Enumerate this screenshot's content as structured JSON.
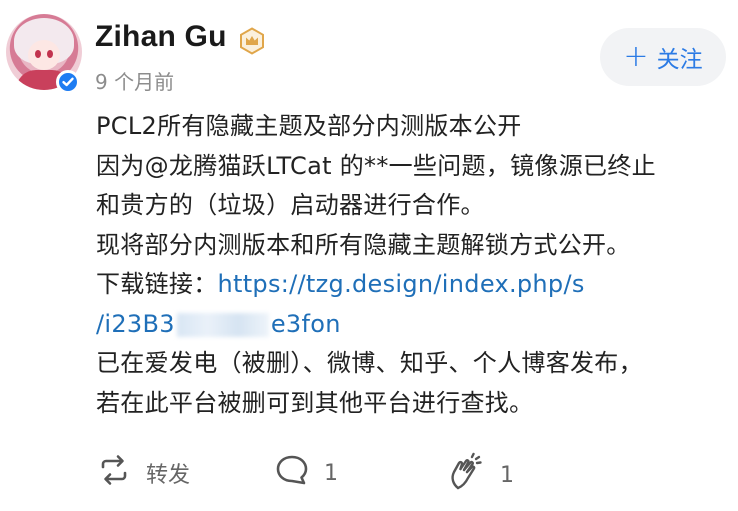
{
  "post": {
    "author": {
      "name": "Zihan Gu"
    },
    "time": "9 个月前",
    "follow_label": "关注",
    "content": {
      "line1": "PCL2所有隐藏主题及部分内测版本公开",
      "line2": "因为@龙腾猫跃LTCat 的**一些问题，镜像源已终止",
      "line3": "和贵方的（垃圾）启动器进行合作。",
      "line4": "现将部分内测版本和所有隐藏主题解锁方式公开。",
      "download_prefix": "下载链接：",
      "link_part1": "https://tzg.design/index.php/s",
      "link_part2_start": "/i23B3",
      "link_part2_end": "e3fon",
      "line7": "已在爱发电（被删）、微博、知乎、个人博客发布，",
      "line8": "若在此平台被删可到其他平台进行查找。"
    },
    "actions": {
      "repost_label": "转发",
      "comment_count": "1",
      "like_count": "1"
    }
  },
  "icons": {
    "verified": "verified-check-icon",
    "badge": "crown-badge-icon",
    "repost": "repost-icon",
    "comment": "comment-bubble-icon",
    "like": "clap-like-icon"
  },
  "colors": {
    "link": "#1f6fb8",
    "follow_text": "#2c7be5",
    "follow_bg": "#f2f3f5",
    "verified": "#1e7cf2",
    "badge": "#e0a64a",
    "meta_gray": "#8c8c8c"
  }
}
